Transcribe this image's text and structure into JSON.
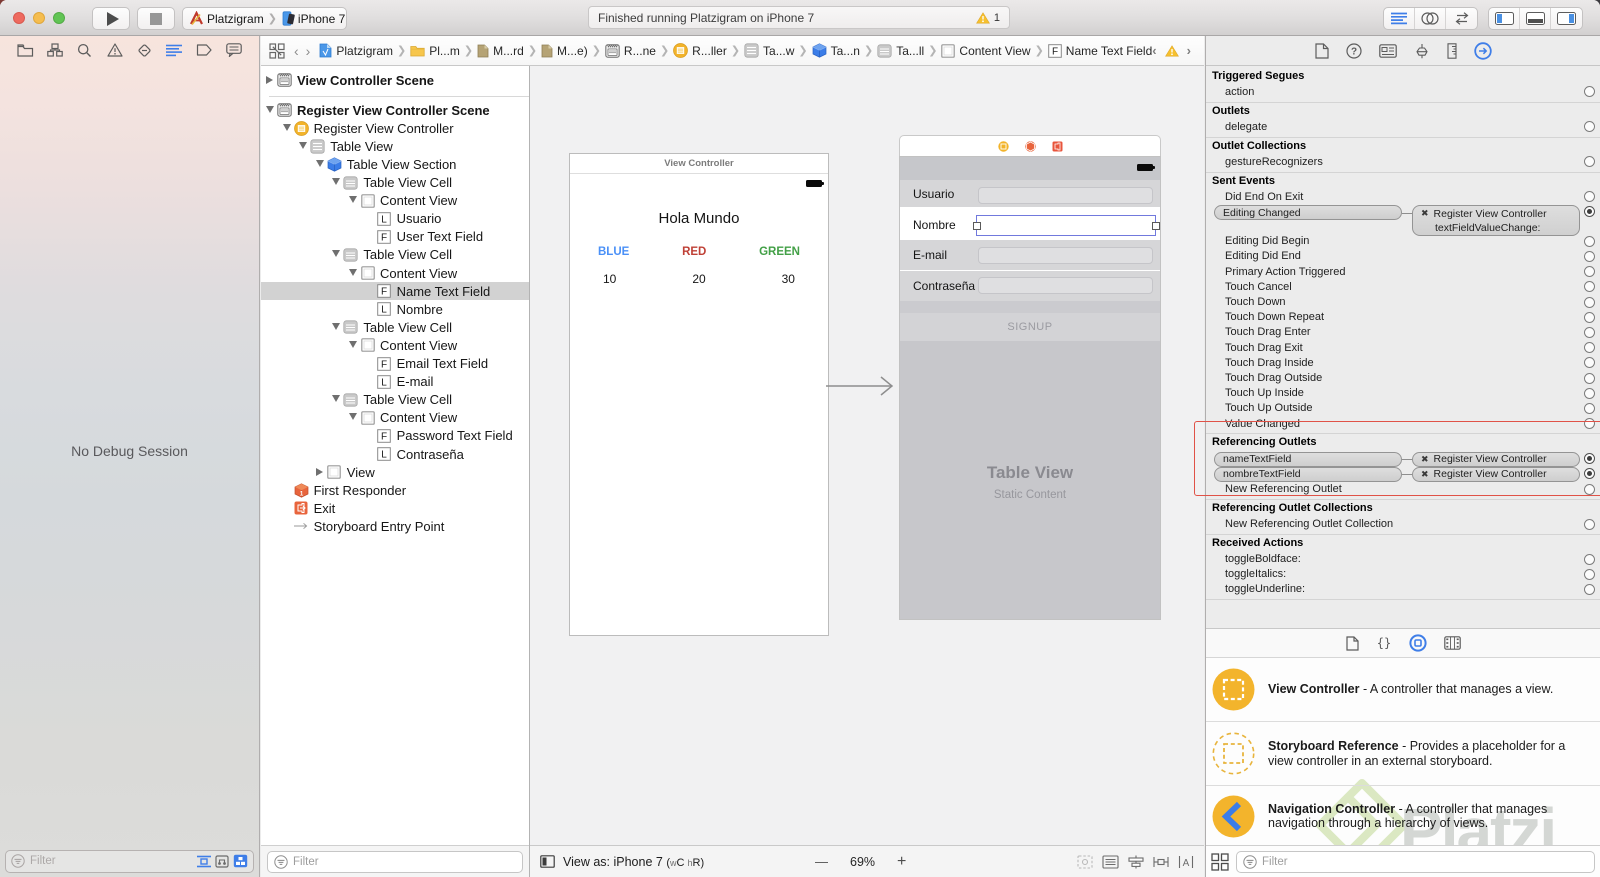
{
  "theme": {
    "accent_blue": "#3f7ee8",
    "selection_gray": "#d2d2d2",
    "annotation_red": "#e05247",
    "icon_yellow": "#f2b32a",
    "watermark_green": "#97c93d"
  },
  "titlebar": {
    "scheme_project": "Platzigram",
    "scheme_device": "iPhone 7",
    "status_message": "Finished running Platzigram on iPhone 7",
    "warning_count": "1"
  },
  "navigator": {
    "icons": [
      "project",
      "symbols",
      "search",
      "issues",
      "tests",
      "debug",
      "breakpoints",
      "reports"
    ],
    "active": "debug",
    "empty_state": "No Debug Session",
    "filter_placeholder": "Filter"
  },
  "jumpbar": {
    "crumbs": [
      {
        "icon": "doc-blue",
        "label": "Platzigram"
      },
      {
        "icon": "folder",
        "label": "Pl...m"
      },
      {
        "icon": "file",
        "label": "M...rd"
      },
      {
        "icon": "file",
        "label": "M...e)"
      },
      {
        "icon": "scene",
        "label": "R...ne"
      },
      {
        "icon": "vc",
        "label": "R...ller"
      },
      {
        "icon": "table",
        "label": "Ta...w"
      },
      {
        "icon": "cube",
        "label": "Ta...n"
      },
      {
        "icon": "cell",
        "label": "Ta...ll"
      },
      {
        "icon": "content",
        "label": "Content View"
      },
      {
        "icon": "field",
        "label": "Name Text Field"
      }
    ]
  },
  "outline": {
    "rows": [
      {
        "label": "View Controller Scene",
        "icon": "scene",
        "level": 0,
        "disclosure": "collapsed",
        "bold": true
      },
      {
        "label": "Register View Controller Scene",
        "icon": "scene",
        "level": 0,
        "disclosure": "expanded",
        "bold": true,
        "sep_before": true
      },
      {
        "label": "Register View Controller",
        "icon": "vc",
        "level": 1,
        "disclosure": "expanded"
      },
      {
        "label": "Table View",
        "icon": "table",
        "level": 2,
        "disclosure": "expanded"
      },
      {
        "label": "Table View Section",
        "icon": "cube",
        "level": 3,
        "disclosure": "expanded"
      },
      {
        "label": "Table View Cell",
        "icon": "cell",
        "level": 4,
        "disclosure": "expanded"
      },
      {
        "label": "Content View",
        "icon": "content",
        "level": 5,
        "disclosure": "expanded"
      },
      {
        "label": "Usuario",
        "icon": "label",
        "level": 6
      },
      {
        "label": "User Text Field",
        "icon": "field",
        "level": 6
      },
      {
        "label": "Table View Cell",
        "icon": "cell",
        "level": 4,
        "disclosure": "expanded"
      },
      {
        "label": "Content View",
        "icon": "content",
        "level": 5,
        "disclosure": "expanded"
      },
      {
        "label": "Name Text Field",
        "icon": "field",
        "level": 6,
        "selected": true
      },
      {
        "label": "Nombre",
        "icon": "label",
        "level": 6
      },
      {
        "label": "Table View Cell",
        "icon": "cell",
        "level": 4,
        "disclosure": "expanded"
      },
      {
        "label": "Content View",
        "icon": "content",
        "level": 5,
        "disclosure": "expanded"
      },
      {
        "label": "Email Text Field",
        "icon": "field",
        "level": 6
      },
      {
        "label": "E-mail",
        "icon": "label",
        "level": 6
      },
      {
        "label": "Table View Cell",
        "icon": "cell",
        "level": 4,
        "disclosure": "expanded"
      },
      {
        "label": "Content View",
        "icon": "content",
        "level": 5,
        "disclosure": "expanded"
      },
      {
        "label": "Password Text Field",
        "icon": "field",
        "level": 6
      },
      {
        "label": "Contraseña",
        "icon": "label",
        "level": 6
      },
      {
        "label": "View",
        "icon": "content",
        "level": 3,
        "disclosure": "collapsed"
      },
      {
        "label": "First Responder",
        "icon": "responder",
        "level": 1
      },
      {
        "label": "Exit",
        "icon": "exit",
        "level": 1
      },
      {
        "label": "Storyboard Entry Point",
        "icon": "entry",
        "level": 1
      }
    ],
    "filter_placeholder": "Filter"
  },
  "canvas": {
    "scene1": {
      "title": "View Controller",
      "heading": "Hola Mundo",
      "buttons": [
        {
          "label": "BLUE",
          "color": "#4a90f7"
        },
        {
          "label": "RED",
          "color": "#bf4036"
        },
        {
          "label": "GREEN",
          "color": "#43a047"
        }
      ],
      "values": [
        "10",
        "20",
        "30"
      ]
    },
    "scene2": {
      "fields": [
        {
          "label": "Usuario",
          "selected": false
        },
        {
          "label": "Nombre",
          "selected": true
        },
        {
          "label": "E-mail",
          "selected": false
        },
        {
          "label": "Contraseña",
          "selected": false
        }
      ],
      "signup_label": "SIGNUP",
      "table_title": "Table View",
      "table_subtitle": "Static Content"
    },
    "bar": {
      "device_label": "View as: iPhone 7",
      "traits_open": "(",
      "traits_w_small": "w",
      "traits_w_big": "C",
      "traits_h_small": "h",
      "traits_h_big": "R",
      "traits_close": ")",
      "zoom_out": "—",
      "zoom_level": "69%",
      "zoom_in": "+"
    }
  },
  "inspector": {
    "sections": [
      {
        "title": "Triggered Segues",
        "rows": [
          {
            "label": "action"
          }
        ]
      },
      {
        "title": "Outlets",
        "rows": [
          {
            "label": "delegate"
          }
        ]
      },
      {
        "title": "Outlet Collections",
        "rows": [
          {
            "label": "gestureRecognizers"
          }
        ]
      },
      {
        "title": "Sent Events",
        "rows": [
          {
            "label": "Did End On Exit"
          },
          {
            "label": "Editing Changed",
            "connection": {
              "target": "Register View Controller",
              "action": "textFieldValueChange:"
            }
          },
          {
            "label": "Editing Did Begin"
          },
          {
            "label": "Editing Did End"
          },
          {
            "label": "Primary Action Triggered"
          },
          {
            "label": "Touch Cancel"
          },
          {
            "label": "Touch Down"
          },
          {
            "label": "Touch Down Repeat"
          },
          {
            "label": "Touch Drag Enter"
          },
          {
            "label": "Touch Drag Exit"
          },
          {
            "label": "Touch Drag Inside"
          },
          {
            "label": "Touch Drag Outside"
          },
          {
            "label": "Touch Up Inside"
          },
          {
            "label": "Touch Up Outside"
          },
          {
            "label": "Value Changed"
          }
        ]
      },
      {
        "title": "Referencing Outlets",
        "rows": [
          {
            "label": "nameTextField",
            "connection": {
              "target": "Register View Controller"
            }
          },
          {
            "label": "nombreTextField",
            "connection": {
              "target": "Register View Controller"
            }
          },
          {
            "label": "New Referencing Outlet"
          }
        ]
      },
      {
        "title": "Referencing Outlet Collections",
        "rows": [
          {
            "label": "New Referencing Outlet Collection"
          }
        ]
      },
      {
        "title": "Received Actions",
        "rows": [
          {
            "label": "toggleBoldface:"
          },
          {
            "label": "toggleItalics:"
          },
          {
            "label": "toggleUnderline:"
          }
        ]
      }
    ]
  },
  "library": {
    "items": [
      {
        "name": "View Controller",
        "description": "A controller that manages a view.",
        "icon": "vc-lib"
      },
      {
        "name": "Storyboard Reference",
        "description": "Provides a placeholder for a view controller in an external storyboard.",
        "icon": "sbref-lib"
      },
      {
        "name": "Navigation Controller",
        "description": "A controller that manages navigation through a hierarchy of views.",
        "icon": "nav-lib"
      }
    ],
    "filter_placeholder": "Filter"
  },
  "watermark": {
    "text": "Platzi"
  }
}
